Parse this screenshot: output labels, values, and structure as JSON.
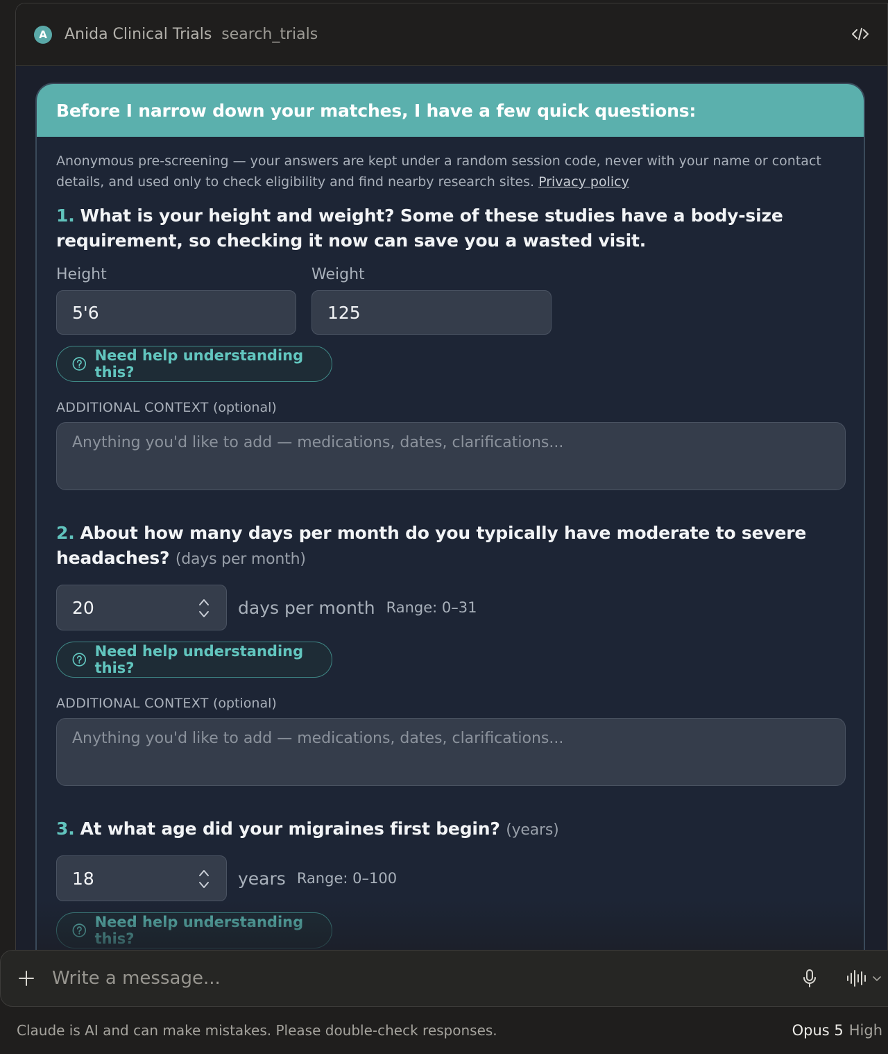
{
  "header": {
    "app_name": "Anida Clinical Trials",
    "tool_name": "search_trials",
    "logo_letter": "A",
    "code_icon": "code-icon"
  },
  "colors": {
    "accent": "#5bb0ad",
    "accent_text": "#62c6bf",
    "panel_bg": "#1d2535",
    "input_bg": "#353d4b"
  },
  "form": {
    "heading": "Before I narrow down your matches, I have a few quick questions:",
    "intro": "Anonymous pre-screening — your answers are kept under a random session code, never with your name or contact details, and used only to check eligibility and find nearby research sites.",
    "privacy_link": "Privacy policy",
    "help_label": "Need help understanding this?",
    "help_icon": "question-circle-icon",
    "context_label": "ADDITIONAL CONTEXT",
    "context_optional": "(optional)",
    "context_placeholder": "Anything you'd like to add — medications, dates, clarifications...",
    "questions": [
      {
        "number": "1.",
        "text": "What is your height and weight? Some of these studies have a body-size requirement, so checking it now can save you a wasted visit.",
        "height_label": "Height",
        "height_value": "5'6",
        "weight_label": "Weight",
        "weight_value": "125"
      },
      {
        "number": "2.",
        "text": "About how many days per month do you typically have moderate to severe headaches?",
        "unit_hint": "(days per month)",
        "value": "20",
        "unit": "days per month",
        "range": "Range: 0–31"
      },
      {
        "number": "3.",
        "text": "At what age did your migraines first begin?",
        "unit_hint": "(years)",
        "value": "18",
        "unit": "years",
        "range": "Range: 0–100"
      }
    ]
  },
  "composer": {
    "placeholder": "Write a message...",
    "plus_icon": "plus-icon",
    "mic_icon": "microphone-icon",
    "voice_icon": "voice-waveform-icon"
  },
  "footer": {
    "disclaimer": "Claude is AI and can make mistakes. Please double-check responses.",
    "model": "Opus 5",
    "effort": "High"
  }
}
